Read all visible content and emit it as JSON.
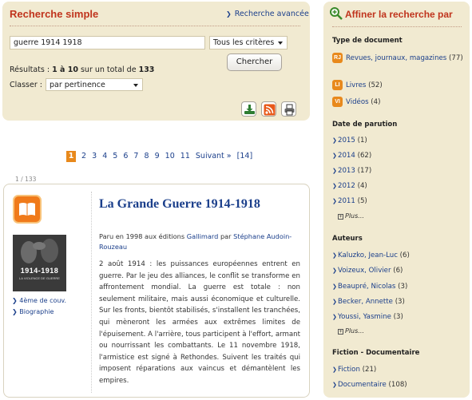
{
  "search": {
    "title": "Recherche simple",
    "advanced_link": "Recherche avancée",
    "query_value": "guerre 1914 1918",
    "criteria_selected": "Tous les critères",
    "button_label": "Chercher",
    "results_prefix": "Résultats : ",
    "results_range": "1 à 10",
    "results_mid": " sur un total de ",
    "results_total": "133",
    "sort_label": "Classer :",
    "sort_selected": "par pertinence"
  },
  "toolbar": {
    "icons": [
      "save-icon",
      "rss-icon",
      "print-icon"
    ]
  },
  "pagination": {
    "current": "1",
    "pages": [
      "2",
      "3",
      "4",
      "5",
      "6",
      "7",
      "8",
      "9",
      "10",
      "11"
    ],
    "next": "Suivant »",
    "last": "[14]"
  },
  "counter": "1 / 133",
  "result": {
    "title": "La Grande Guerre 1914-1918",
    "pub_prefix": "Paru en ",
    "year": "1998",
    "pub_mid": " aux éditions ",
    "publisher": "Gallimard",
    "pub_by": " par ",
    "author": "Stéphane Audoin-Rouzeau",
    "cover_title": "1914-1918",
    "cover_subtitle": "LA VIOLENCE DE GUERRE",
    "links": [
      "4ème de couv.",
      "Biographie"
    ],
    "summary": "2 août 1914 : les puissances européennes entrent en guerre. Par le jeu des alliances, le conflit se transforme en affrontement mondial. La guerre est totale : non seulement militaire, mais aussi économique et culturelle. Sur les fronts, bientôt stabilisés, s'installent les tranchées, qui mèneront les armées aux extrêmes limites de l'épuisement. A l'arrière, tous participent à l'effort, armant ou nourrissant les combattants. Le 11 novembre 1918, l'armistice est signé à Rethondes. Suivent les traités qui imposent réparations aux vaincus et démantèlent les empires."
  },
  "facets": {
    "title": "Affiner la recherche par",
    "doc_type": {
      "heading": "Type de document",
      "items": [
        {
          "icon": "RJ",
          "label": "Revues, journaux, magazines",
          "count": "(77)"
        },
        {
          "icon": "LI",
          "label": "Livres",
          "count": "(52)"
        },
        {
          "icon": "VI",
          "label": "Vidéos",
          "count": "(4)"
        }
      ]
    },
    "date": {
      "heading": "Date de parution",
      "items": [
        {
          "label": "2015",
          "count": "(1)"
        },
        {
          "label": "2014",
          "count": "(62)"
        },
        {
          "label": "2013",
          "count": "(17)"
        },
        {
          "label": "2012",
          "count": "(4)"
        },
        {
          "label": "2011",
          "count": "(5)"
        }
      ],
      "more": "Plus..."
    },
    "authors": {
      "heading": "Auteurs",
      "items": [
        {
          "label": "Kaluzko, Jean-Luc",
          "count": "(6)"
        },
        {
          "label": "Voizeux, Olivier",
          "count": "(6)"
        },
        {
          "label": "Beaupré, Nicolas",
          "count": "(3)"
        },
        {
          "label": "Becker, Annette",
          "count": "(3)"
        },
        {
          "label": "Youssi, Yasmine",
          "count": "(3)"
        }
      ],
      "more": "Plus..."
    },
    "fiction": {
      "heading": "Fiction - Documentaire",
      "items": [
        {
          "label": "Fiction",
          "count": "(21)"
        },
        {
          "label": "Documentaire",
          "count": "(108)"
        }
      ]
    }
  },
  "colors": {
    "accent": "#c0341d",
    "link": "#1b3f8b",
    "panel": "#f1ead1",
    "orange": "#e8891c"
  }
}
